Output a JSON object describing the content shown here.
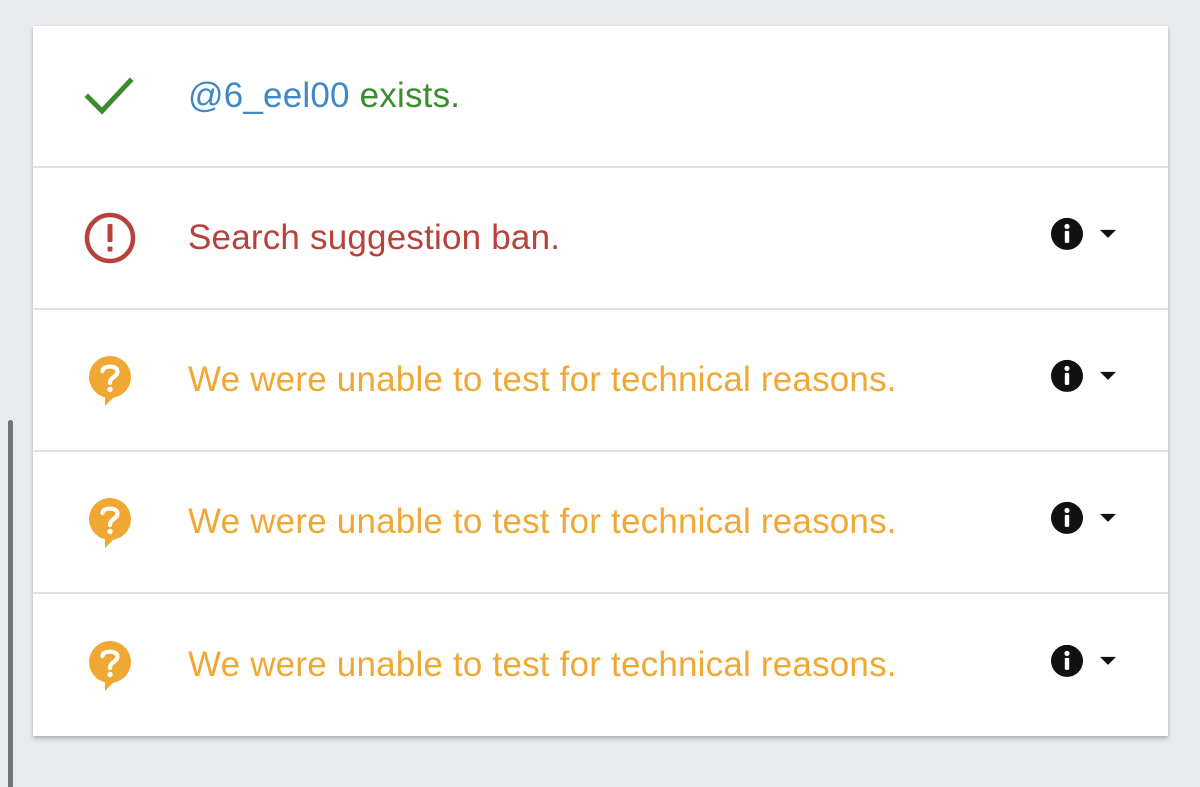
{
  "colors": {
    "background": "#e8eaee",
    "card": "#ffffff",
    "handle": "#3f87c6",
    "success": "#3b8c2e",
    "error": "#b8413b",
    "warning": "#f0a835",
    "divider": "#dfe1e4"
  },
  "rows": [
    {
      "status": "success",
      "icon": "check-icon",
      "handle": "@6_eel00",
      "text": "exists."
    },
    {
      "status": "error",
      "icon": "exclamation-circle-icon",
      "text": "Search suggestion ban.",
      "info_icon": "info-icon",
      "dropdown_icon": "chevron-down-icon"
    },
    {
      "status": "warning",
      "icon": "question-bubble-icon",
      "text": "We were unable to test for technical reasons.",
      "info_icon": "info-icon",
      "dropdown_icon": "chevron-down-icon"
    },
    {
      "status": "warning",
      "icon": "question-bubble-icon",
      "text": "We were unable to test for technical reasons.",
      "info_icon": "info-icon",
      "dropdown_icon": "chevron-down-icon"
    },
    {
      "status": "warning",
      "icon": "question-bubble-icon",
      "text": "We were unable to test for technical reasons.",
      "info_icon": "info-icon",
      "dropdown_icon": "chevron-down-icon"
    }
  ]
}
